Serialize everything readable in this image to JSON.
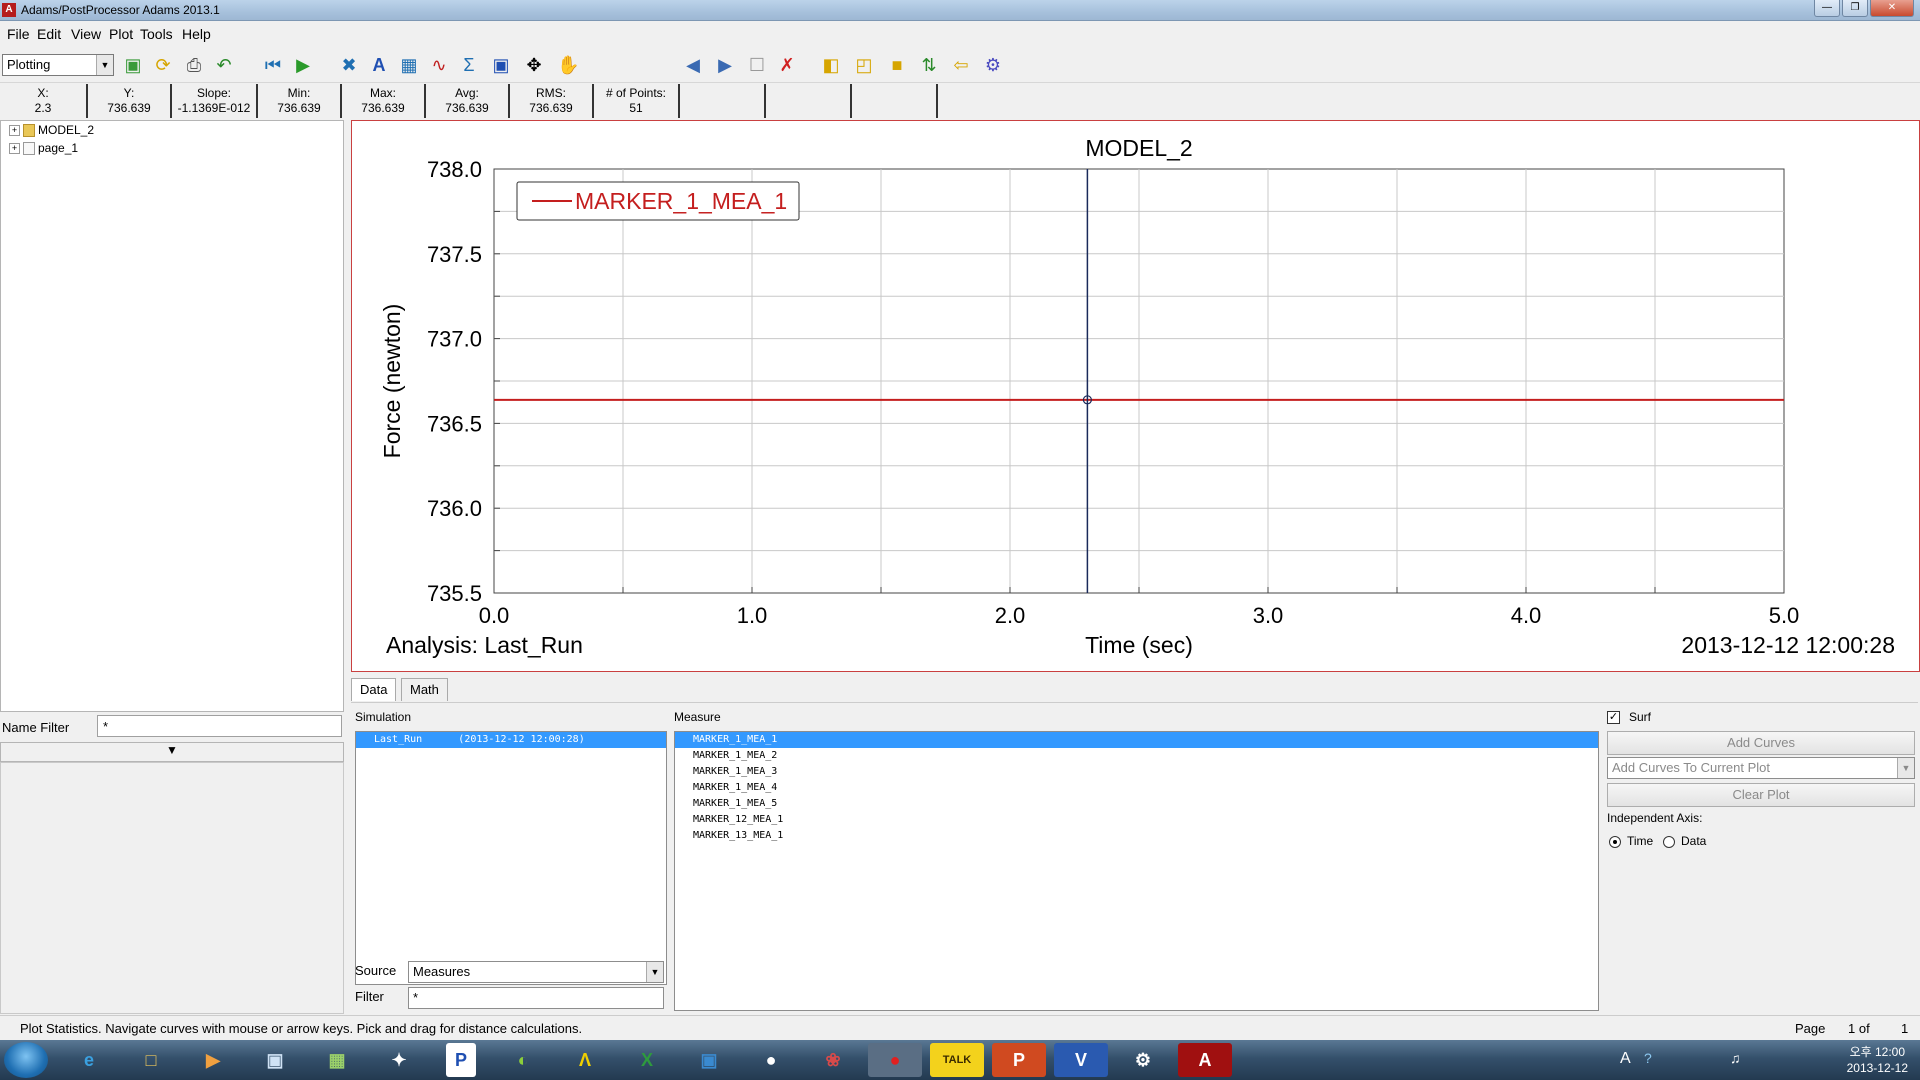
{
  "window": {
    "title": "Adams/PostProcessor Adams 2013.1",
    "app_icon": "A"
  },
  "menu": [
    "File",
    "Edit",
    "View",
    "Plot",
    "Tools",
    "Help"
  ],
  "toolbar": {
    "mode": "Plotting",
    "icons": [
      "new-page-icon",
      "refresh-icon",
      "print-icon",
      "undo-icon",
      "rewind-icon",
      "play-icon",
      "fit-icon",
      "text-icon",
      "grid-icon",
      "curve-icon",
      "sigma-icon",
      "zoom-box-icon",
      "fit-all-icon",
      "pan-icon",
      "prev-page-icon",
      "next-page-icon",
      "new-page-layout-icon",
      "delete-page-icon",
      "layout-left-icon",
      "layout-top-icon",
      "layout-box-icon",
      "swap-icon",
      "export-icon",
      "settings-icon"
    ]
  },
  "stats": [
    {
      "label": "X:",
      "value": "2.3"
    },
    {
      "label": "Y:",
      "value": "736.639"
    },
    {
      "label": "Slope:",
      "value": "-1.1369E-012"
    },
    {
      "label": "Min:",
      "value": "736.639"
    },
    {
      "label": "Max:",
      "value": "736.639"
    },
    {
      "label": "Avg:",
      "value": "736.639"
    },
    {
      "label": "RMS:",
      "value": "736.639"
    },
    {
      "label": "# of Points:",
      "value": "51"
    },
    {
      "label": "",
      "value": ""
    },
    {
      "label": "",
      "value": ""
    },
    {
      "label": "",
      "value": ""
    }
  ],
  "tree": [
    {
      "label": "MODEL_2"
    },
    {
      "label": "page_1"
    }
  ],
  "name_filter": {
    "label": "Name Filter",
    "value": "*"
  },
  "plot": {
    "analysis_label": "Analysis:  Last_Run",
    "timestamp": "2013-12-12 12:00:28",
    "cursor_x": 2.3
  },
  "chart_data": {
    "type": "line",
    "title": "MODEL_2",
    "xlabel": "Time (sec)",
    "ylabel": "Force (newton)",
    "xlim": [
      0.0,
      5.0
    ],
    "ylim": [
      735.5,
      738.0
    ],
    "xticks": [
      "0.0",
      "1.0",
      "2.0",
      "3.0",
      "4.0",
      "5.0"
    ],
    "yticks": [
      "738.0",
      "737.5",
      "737.0",
      "736.5",
      "736.0",
      "735.5"
    ],
    "grid": true,
    "legend": "top-left",
    "series": [
      {
        "name": "MARKER_1_MEA_1",
        "color": "#c41e1e",
        "x": [
          0.0,
          5.0
        ],
        "y": [
          736.639,
          736.639
        ]
      }
    ]
  },
  "tabs": [
    "Data",
    "Math"
  ],
  "simulation": {
    "label": "Simulation",
    "rows": [
      {
        "name": "Last_Run",
        "time": "(2013-12-12 12:00:28)"
      }
    ]
  },
  "measure": {
    "label": "Measure",
    "rows": [
      "MARKER_1_MEA_1",
      "MARKER_1_MEA_2",
      "MARKER_1_MEA_3",
      "MARKER_1_MEA_4",
      "MARKER_1_MEA_5",
      "MARKER_12_MEA_1",
      "MARKER_13_MEA_1"
    ]
  },
  "source": {
    "label": "Source",
    "value": "Measures"
  },
  "filter": {
    "label": "Filter",
    "value": "*"
  },
  "right_panel": {
    "surf_label": "Surf",
    "add_curves": "Add Curves",
    "add_mode": "Add Curves To Current Plot",
    "clear_plot": "Clear Plot",
    "independent_axis": "Independent Axis:",
    "opt_time": "Time",
    "opt_data": "Data"
  },
  "status": {
    "message": "Plot Statistics.  Navigate curves with mouse or arrow keys.  Pick and drag for distance calculations.",
    "page_label": "Page",
    "page_of": "1 of",
    "page_total": "1"
  },
  "taskbar": {
    "apps": [
      "ie-icon",
      "explorer-icon",
      "media-player-icon",
      "window-icon",
      "screenshot-icon",
      "tool-icon",
      "p-app-icon",
      "moon-app-icon",
      "arrow-app-icon",
      "excel-icon",
      "network-app-icon",
      "penguin-app-icon",
      "paint-icon",
      "record-icon",
      "kakaotalk-icon",
      "powerpoint-icon",
      "word-icon",
      "settings-app-icon",
      "adams-icon"
    ],
    "tray_lang": "A",
    "clock_time": "오후 12:00",
    "clock_date": "2013-12-12"
  }
}
